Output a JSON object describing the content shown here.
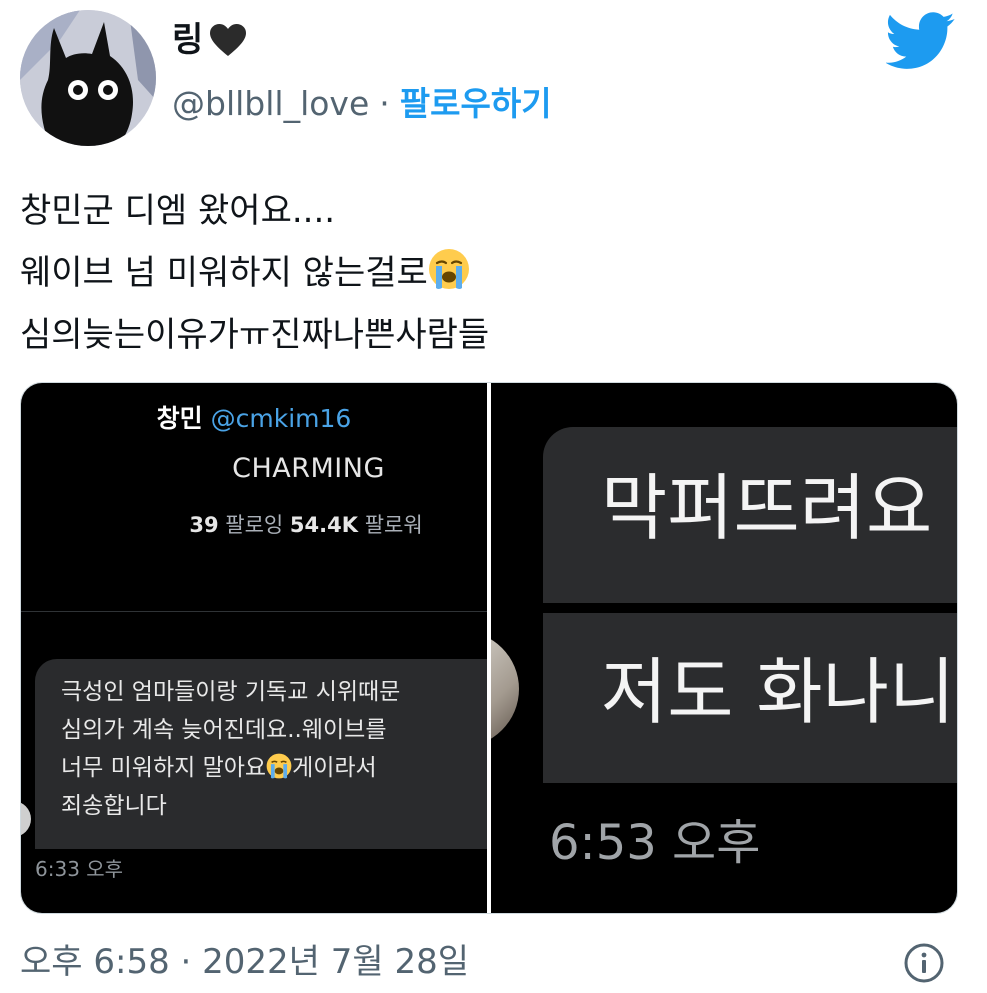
{
  "author": {
    "display_name": "링",
    "heart_glyph": "🖤",
    "handle": "@bllbll_love",
    "separator": "·",
    "follow_label": "팔로우하기"
  },
  "tweet": {
    "lines": [
      "창민군 디엠 왔어요....",
      "웨이브 넘 미워하지 않는걸로",
      "심의늦는이유가ㅠ진짜나쁜사람들"
    ],
    "emoji": "loudly-crying-face"
  },
  "media": {
    "left": {
      "name": "창민",
      "handle": "@cmkim16",
      "bio": "CHARMING",
      "following_count": "39",
      "following_label": "팔로잉",
      "followers_count": "54.4K",
      "followers_label": "팔로워",
      "message_lines": [
        "극성인 엄마들이랑 기독교 시위때문",
        "심의가 계속 늦어진데요..웨이브를",
        "너무 미워하지 말아요",
        "게이라서",
        "죄송합니다"
      ],
      "time": "6:33 오후"
    },
    "right": {
      "message_top": "막퍼뜨려요",
      "message_bottom": "저도 화나니",
      "time": "6:53 오후"
    }
  },
  "footer": {
    "time": "오후 6:58",
    "separator": "·",
    "date": "2022년 7월 28일"
  },
  "icons": {
    "brand": "twitter-bird-icon",
    "info": "info-icon"
  },
  "colors": {
    "accent": "#1d9bf0",
    "secondary_text": "#536471",
    "primary_text": "#0f1419"
  }
}
